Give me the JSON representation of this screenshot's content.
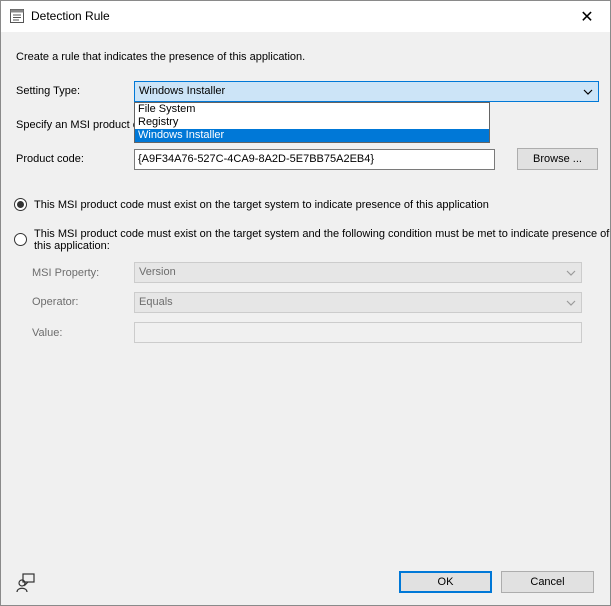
{
  "window": {
    "title": "Detection Rule",
    "icon": "dialog-icon",
    "close_glyph": "✕"
  },
  "intro_text": "Create a rule that indicates the presence of this application.",
  "setting_type": {
    "label": "Setting Type:",
    "value": "Windows Installer",
    "options": [
      "File System",
      "Registry",
      "Windows Installer"
    ],
    "selected_index": 2
  },
  "specify_text": "Specify an MSI product c",
  "product_code": {
    "label": "Product code:",
    "value": "{A9F34A76-527C-4CA9-8A2D-5E7BB75A2EB4}",
    "browse_label": "Browse ..."
  },
  "radio_options": [
    {
      "label": "This MSI product code must exist on the target system to indicate presence of this application",
      "checked": true
    },
    {
      "label_line1": "This MSI product code must exist on the target system and the following condition must be met to indicate presence of",
      "label_line2": "this application:",
      "checked": false
    }
  ],
  "condition": {
    "msi_property_label": "MSI Property:",
    "msi_property_value": "Version",
    "operator_label": "Operator:",
    "operator_value": "Equals",
    "value_label": "Value:",
    "value_value": ""
  },
  "footer": {
    "ok_label": "OK",
    "cancel_label": "Cancel",
    "feedback_icon": "feedback-icon"
  }
}
